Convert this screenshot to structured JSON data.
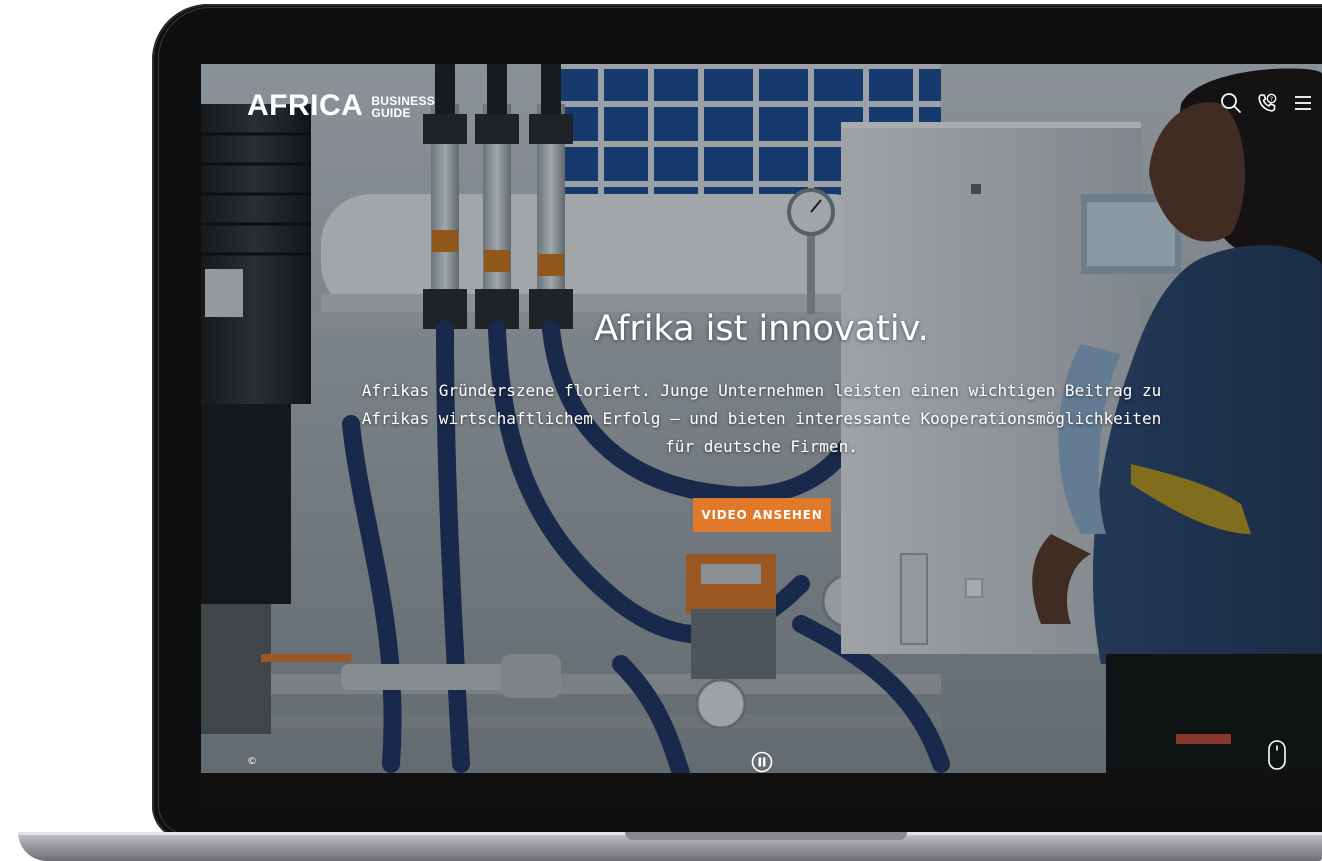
{
  "header": {
    "logo_main": "AFRICA",
    "logo_sub_line1": "BUSINESS",
    "logo_sub_line2": "GUIDE",
    "icons": [
      "search-icon",
      "phone-icon",
      "menu-icon"
    ]
  },
  "hero": {
    "title": "Afrika ist innovativ.",
    "text": "Afrikas Gründerszene floriert. Junge Unternehmen leisten einen wichtigen Beitrag zu Afrikas wirtschaftlichem Erfolg – und bieten interessante Kooperationsmöglichkeiten für deutsche Firmen.",
    "cta_label": "VIDEO ANSEHEN"
  },
  "footer": {
    "copyright_symbol": "©",
    "controls": [
      "pause-icon",
      "scroll-mouse-icon"
    ]
  },
  "colors": {
    "accent": "#e07a2a",
    "text": "#ffffff",
    "laptop_frame": "#0f0f10"
  }
}
